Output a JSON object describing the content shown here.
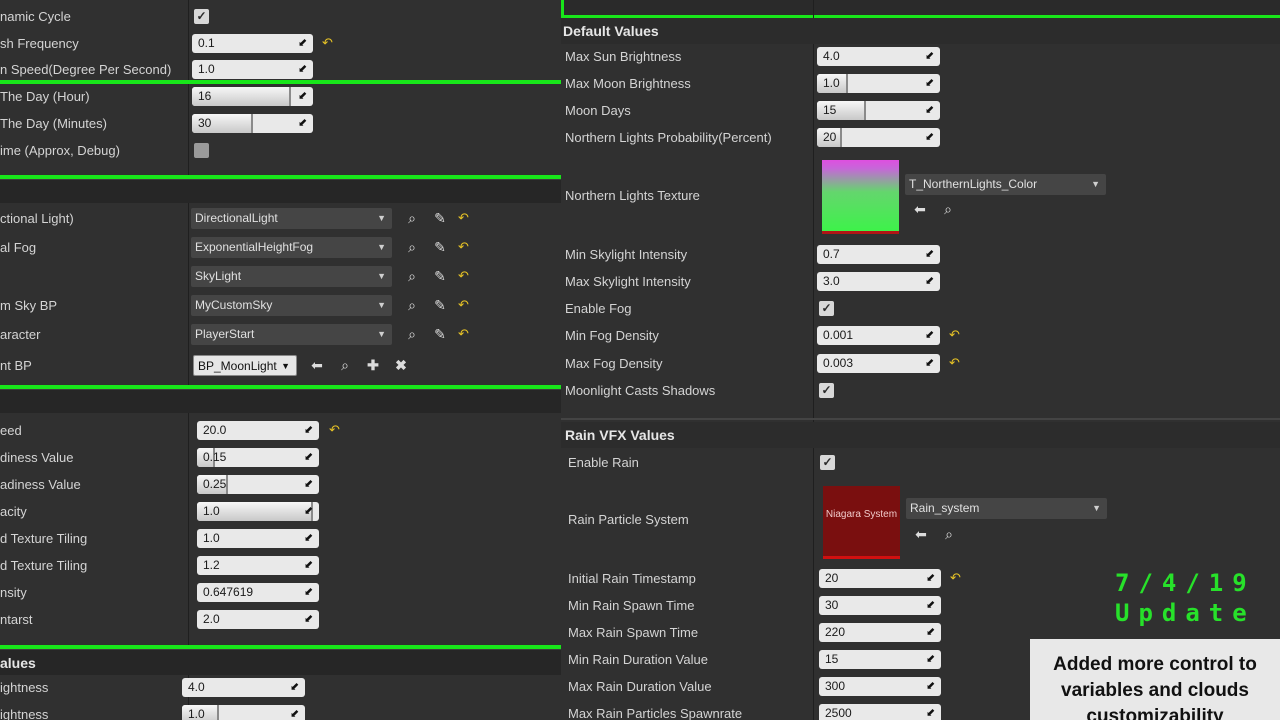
{
  "left": {
    "rows": [
      {
        "label": "namic Cycle",
        "kind": "check",
        "checked": true
      },
      {
        "label": "sh Frequency",
        "kind": "num",
        "value": "0.1",
        "reset": true
      },
      {
        "label": "n Speed(Degree Per Second)",
        "kind": "num",
        "value": "1.0"
      },
      {
        "label": "The Day (Hour)",
        "kind": "num",
        "value": "16",
        "fill": 0.82
      },
      {
        "label": "The Day (Minutes)",
        "kind": "num",
        "value": "30",
        "fill": 0.5
      },
      {
        "label": "ime (Approx, Debug)",
        "kind": "check",
        "checked": false
      },
      {
        "label": "ctional Light)",
        "kind": "dd",
        "value": "DirectionalLight"
      },
      {
        "label": "al Fog",
        "kind": "dd",
        "value": "ExponentialHeightFog"
      },
      {
        "label": "",
        "kind": "dd",
        "value": "SkyLight"
      },
      {
        "label": "m Sky BP",
        "kind": "dd",
        "value": "MyCustomSky"
      },
      {
        "label": "aracter",
        "kind": "dd",
        "value": "PlayerStart"
      },
      {
        "label": "nt BP",
        "kind": "bp",
        "value": "BP_MoonLight"
      },
      {
        "label": "eed",
        "kind": "num",
        "value": "20.0",
        "reset": true
      },
      {
        "label": "diness Value",
        "kind": "num",
        "value": "0.15",
        "fill": 0.15
      },
      {
        "label": "adiness Value",
        "kind": "num",
        "value": "0.25",
        "fill": 0.25
      },
      {
        "label": "acity",
        "kind": "num",
        "value": "1.0",
        "fill": 0.95
      },
      {
        "label": "d Texture Tiling",
        "kind": "num",
        "value": "1.0"
      },
      {
        "label": "d Texture Tiling",
        "kind": "num",
        "value": "1.2"
      },
      {
        "label": "nsity",
        "kind": "num",
        "value": "0.647619"
      },
      {
        "label": "ntarst",
        "kind": "num",
        "value": "2.0"
      },
      {
        "label": "ightness",
        "kind": "num",
        "value": "4.0"
      },
      {
        "label": "ightness",
        "kind": "num",
        "value": "1.0",
        "fill": 0.3
      }
    ],
    "section_values": "alues"
  },
  "right": {
    "section_default": "Default Values",
    "section_rain": "Rain VFX Values",
    "rows": [
      {
        "label": "Max Sun Brightness",
        "kind": "num",
        "value": "4.0"
      },
      {
        "label": "Max Moon Brightness",
        "kind": "num",
        "value": "1.0",
        "fill": 0.25
      },
      {
        "label": "Moon Days",
        "kind": "num",
        "value": "15",
        "fill": 0.4
      },
      {
        "label": "Northern Lights Probability(Percent)",
        "kind": "num",
        "value": "20",
        "fill": 0.2
      },
      {
        "label": "Northern Lights Texture",
        "kind": "asset",
        "value": "T_NorthernLights_Color"
      },
      {
        "label": "Min Skylight Intensity",
        "kind": "num",
        "value": "0.7"
      },
      {
        "label": "Max Skylight Intensity",
        "kind": "num",
        "value": "3.0"
      },
      {
        "label": "Enable Fog",
        "kind": "check",
        "checked": true
      },
      {
        "label": "Min Fog Density",
        "kind": "num",
        "value": "0.001",
        "reset": true
      },
      {
        "label": "Max Fog Density",
        "kind": "num",
        "value": "0.003",
        "reset": true
      },
      {
        "label": "Moonlight Casts Shadows",
        "kind": "check",
        "checked": true
      },
      {
        "label": "Enable Rain",
        "kind": "check",
        "checked": true
      },
      {
        "label": "Rain Particle System",
        "kind": "asset",
        "value": "Rain_system"
      },
      {
        "label": "Initial Rain Timestamp",
        "kind": "num",
        "value": "20",
        "reset": true
      },
      {
        "label": "Min Rain Spawn Time",
        "kind": "num",
        "value": "30"
      },
      {
        "label": "Max Rain Spawn Time",
        "kind": "num",
        "value": "220"
      },
      {
        "label": "Min Rain Duration Value",
        "kind": "num",
        "value": "15"
      },
      {
        "label": "Max Rain Duration Value",
        "kind": "num",
        "value": "300"
      },
      {
        "label": "Max Rain Particles Spawnrate",
        "kind": "num",
        "value": "2500"
      }
    ],
    "niagara_thumb": "Niagara System"
  },
  "overlay": {
    "update_line1": "7/4/19",
    "update_line2": "Update",
    "banner_line1": "Added more control to",
    "banner_line2": "variables and clouds",
    "banner_line3": "customizability"
  },
  "icons": {
    "check": "checkmark-icon",
    "reset": "reset-to-default-icon",
    "browse": "search-icon",
    "pick": "eyedropper-icon",
    "use": "arrow-left-icon",
    "add": "plus-icon",
    "clear": "close-icon",
    "combo": "chevron-down-icon",
    "drag": "drag-arrow-icon"
  },
  "colors": {
    "accent_green": "#18e61a",
    "reset_yellow": "#e7c326",
    "panel": "#303030"
  }
}
